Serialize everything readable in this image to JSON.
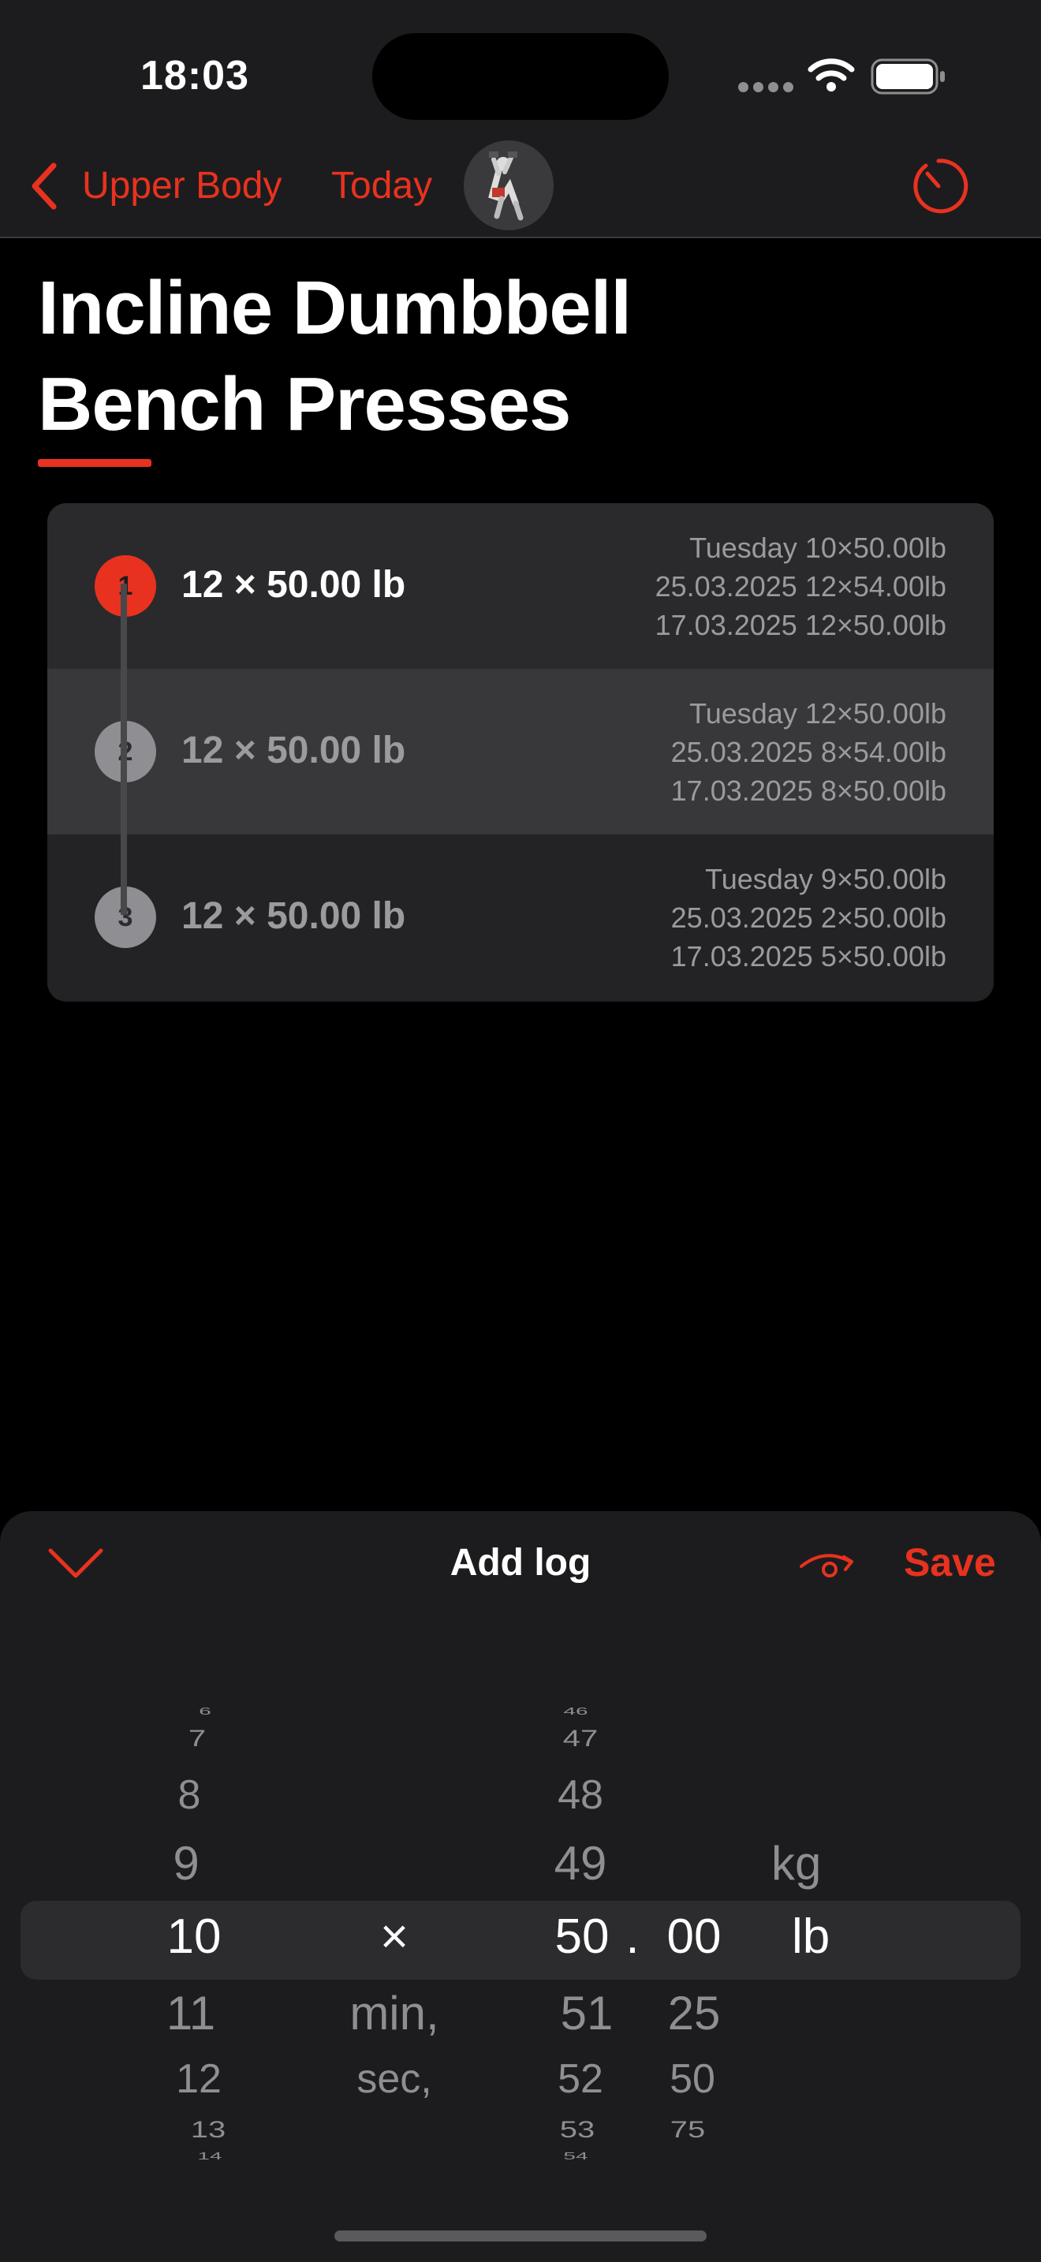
{
  "status_bar": {
    "time": "18:03"
  },
  "nav": {
    "back_label": "Upper Body",
    "today_label": "Today"
  },
  "exercise": {
    "title_line1": "Incline Dumbbell",
    "title_line2": "Bench Presses"
  },
  "sets": [
    {
      "number": "1",
      "summary": "12 × 50.00 lb",
      "history": [
        "Tuesday 10×50.00lb",
        "25.03.2025 12×54.00lb",
        "17.03.2025 12×50.00lb"
      ]
    },
    {
      "number": "2",
      "summary": "12 × 50.00 lb",
      "history": [
        "Tuesday 12×50.00lb",
        "25.03.2025 8×54.00lb",
        "17.03.2025 8×50.00lb"
      ]
    },
    {
      "number": "3",
      "summary": "12 × 50.00 lb",
      "history": [
        "Tuesday 9×50.00lb",
        "25.03.2025 2×50.00lb",
        "17.03.2025 5×50.00lb"
      ]
    }
  ],
  "sheet": {
    "title": "Add log",
    "save_label": "Save"
  },
  "picker": {
    "reps": [
      "6",
      "7",
      "8",
      "9",
      "10",
      "11",
      "12",
      "13",
      "14"
    ],
    "separator": [
      "×",
      "min,",
      "sec,"
    ],
    "weight_whole": [
      "46",
      "47",
      "48",
      "49",
      "50",
      "51",
      "52",
      "53",
      "54"
    ],
    "decimal_point": ".",
    "weight_fraction": [
      "00",
      "25",
      "50",
      "75"
    ],
    "units": [
      "kg",
      "lb"
    ]
  },
  "colors": {
    "accent": "#e8321f",
    "background": "#000000",
    "surface": "#1c1c1e"
  },
  "icons": [
    "chevron-left-icon",
    "timer-icon",
    "chevron-down-icon",
    "rotation-icon",
    "wifi-icon",
    "battery-icon"
  ]
}
